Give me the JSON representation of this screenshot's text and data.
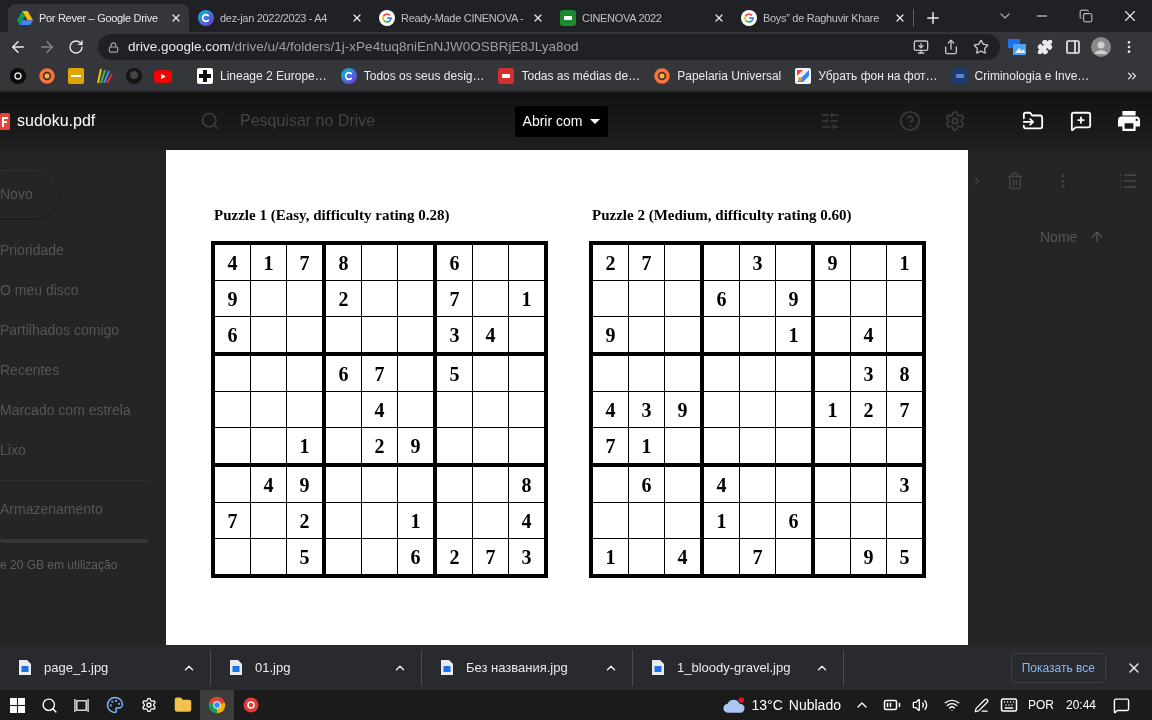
{
  "browser": {
    "tabs": [
      {
        "title": "Por Rever – Google Drive",
        "selected": true
      },
      {
        "title": "dez-jan 2022/2023 - A4",
        "selected": false
      },
      {
        "title": "Ready-Made CINENOVA -",
        "selected": false
      },
      {
        "title": "CINENOVA 2022",
        "selected": false
      },
      {
        "title": "Boys” de Raghuvir Khare",
        "selected": false
      }
    ],
    "address": {
      "host": "drive.google.com",
      "path": "/drive/u/4/folders/1j-xPe4tuq8niEnNJW0OSBRjE8JLya8od"
    },
    "bookmarks": [
      {
        "label": "Lineage 2 Europe…"
      },
      {
        "label": "Todos os seus desig…"
      },
      {
        "label": "Todas as médias de…"
      },
      {
        "label": "Papelaria Universal"
      },
      {
        "label": "Убрать фон на фот…"
      },
      {
        "label": "Criminologia e Inve…"
      }
    ]
  },
  "drive": {
    "search": {
      "placeholder": "Pesquisar no Drive"
    },
    "new_button": "Novo",
    "sidebar": {
      "items": [
        {
          "label": "Prioridade",
          "selected": false
        },
        {
          "label": "O meu disco",
          "selected": false
        },
        {
          "label": "Partilhados comigo",
          "selected": false
        },
        {
          "label": "Recentes",
          "selected": false
        },
        {
          "label": "Marcado com estrela",
          "selected": false
        },
        {
          "label": "Lixo",
          "selected": false
        }
      ],
      "storage": {
        "label": "Armazenamento",
        "usage": "e 20 GB em utilização"
      }
    },
    "list": {
      "sort_column": "Nome"
    }
  },
  "viewer": {
    "file_name": "sudoku.pdf",
    "open_with": "Abrir com",
    "puzzles": [
      {
        "title": "Puzzle 1 (Easy, difficulty rating 0.28)",
        "rows": [
          [
            "4",
            "1",
            "7",
            "8",
            null,
            null,
            "6",
            null,
            null
          ],
          [
            "9",
            null,
            null,
            "2",
            null,
            null,
            "7",
            null,
            "1"
          ],
          [
            "6",
            null,
            null,
            null,
            null,
            null,
            "3",
            "4",
            null
          ],
          [
            null,
            null,
            null,
            "6",
            "7",
            null,
            "5",
            null,
            null
          ],
          [
            null,
            null,
            null,
            null,
            "4",
            null,
            null,
            null,
            null
          ],
          [
            null,
            null,
            "1",
            null,
            "2",
            "9",
            null,
            null,
            null
          ],
          [
            null,
            "4",
            "9",
            null,
            null,
            null,
            null,
            null,
            "8"
          ],
          [
            "7",
            null,
            "2",
            null,
            null,
            "1",
            null,
            null,
            "4"
          ],
          [
            null,
            null,
            "5",
            null,
            null,
            "6",
            "2",
            "7",
            "3"
          ]
        ]
      },
      {
        "title": "Puzzle 2 (Medium, difficulty rating 0.60)",
        "rows": [
          [
            "2",
            "7",
            null,
            null,
            "3",
            null,
            "9",
            null,
            "1"
          ],
          [
            null,
            null,
            null,
            "6",
            null,
            "9",
            null,
            null,
            null
          ],
          [
            "9",
            null,
            null,
            null,
            null,
            "1",
            null,
            "4",
            null
          ],
          [
            null,
            null,
            null,
            null,
            null,
            null,
            null,
            "3",
            "8"
          ],
          [
            "4",
            "3",
            "9",
            null,
            null,
            null,
            "1",
            "2",
            "7"
          ],
          [
            "7",
            "1",
            null,
            null,
            null,
            null,
            null,
            null,
            null
          ],
          [
            null,
            "6",
            null,
            "4",
            null,
            null,
            null,
            null,
            "3"
          ],
          [
            null,
            null,
            null,
            "1",
            null,
            "6",
            null,
            null,
            null
          ],
          [
            "1",
            null,
            "4",
            null,
            "7",
            null,
            null,
            "9",
            "5"
          ]
        ]
      }
    ]
  },
  "downloads": {
    "items": [
      {
        "name": "page_1.jpg"
      },
      {
        "name": "01.jpg"
      },
      {
        "name": "Без названия.jpg"
      },
      {
        "name": "1_bloody-gravel.jpg"
      }
    ],
    "show_all": "Показать все"
  },
  "taskbar": {
    "apps": [
      {
        "selected": false
      },
      {
        "selected": false
      },
      {
        "selected": false
      },
      {
        "selected": true
      },
      {
        "selected": false
      }
    ],
    "weather": {
      "temperature": "13°C",
      "condition": "Nublado"
    },
    "language": "POR",
    "time": "20:44"
  }
}
